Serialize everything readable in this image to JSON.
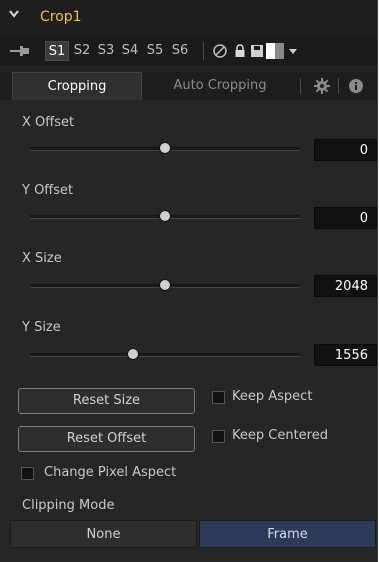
{
  "header": {
    "title": "Crop1"
  },
  "toolbar": {
    "versions": [
      "S1",
      "S2",
      "S3",
      "S4",
      "S5",
      "S6"
    ],
    "active_version": "S1"
  },
  "tabs": [
    {
      "label": "Cropping",
      "active": true
    },
    {
      "label": "Auto Cropping",
      "active": false
    }
  ],
  "controls": {
    "x_offset": {
      "label": "X Offset",
      "value": "0",
      "slider_fraction": 0.5
    },
    "y_offset": {
      "label": "Y Offset",
      "value": "0",
      "slider_fraction": 0.5
    },
    "x_size": {
      "label": "X Size",
      "value": "2048",
      "slider_fraction": 0.5
    },
    "y_size": {
      "label": "Y Size",
      "value": "1556",
      "slider_fraction": 0.38
    }
  },
  "buttons": {
    "reset_size": "Reset Size",
    "reset_offset": "Reset Offset"
  },
  "checkboxes": {
    "keep_aspect": {
      "label": "Keep Aspect",
      "checked": false
    },
    "keep_centered": {
      "label": "Keep Centered",
      "checked": false
    },
    "change_pixel_aspect": {
      "label": "Change Pixel Aspect",
      "checked": false
    }
  },
  "clipping": {
    "label": "Clipping Mode",
    "options": [
      "None",
      "Frame"
    ],
    "selected": "Frame"
  },
  "colors": {
    "title": "#f0c23b",
    "selected_mode": "#2d3a58",
    "panel_bg": "#262626"
  }
}
